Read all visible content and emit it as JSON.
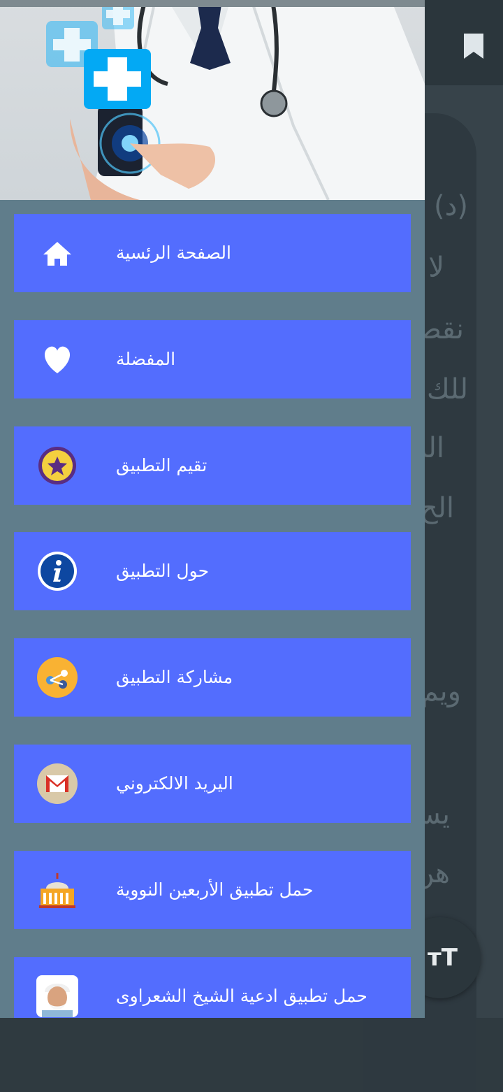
{
  "background": {
    "text_lines": [
      "(د)",
      "لا",
      "نقص",
      "للك",
      "الب",
      "الح",
      "ويم",
      "يس",
      "هن"
    ],
    "fab_label": "тT"
  },
  "drawer": {
    "menu": [
      {
        "label": "الصفحة الرئسية",
        "icon": "home-icon"
      },
      {
        "label": "المفضلة",
        "icon": "heart-icon"
      },
      {
        "label": "تقيم التطبيق",
        "icon": "star-icon"
      },
      {
        "label": "حول التطبيق",
        "icon": "info-icon"
      },
      {
        "label": "مشاركة التطبيق",
        "icon": "share-icon"
      },
      {
        "label": "اليريد الالكتروني",
        "icon": "gmail-icon"
      },
      {
        "label": "حمل تطبيق الأربعين النووية",
        "icon": "mosque-icon"
      },
      {
        "label": "حمل تطبيق ادعية الشيخ الشعراوى",
        "icon": "sheikh-avatar-icon"
      }
    ]
  },
  "colors": {
    "drawer_bg": "#607d8b",
    "item_bg": "#536dfe",
    "text": "#ffffff"
  }
}
